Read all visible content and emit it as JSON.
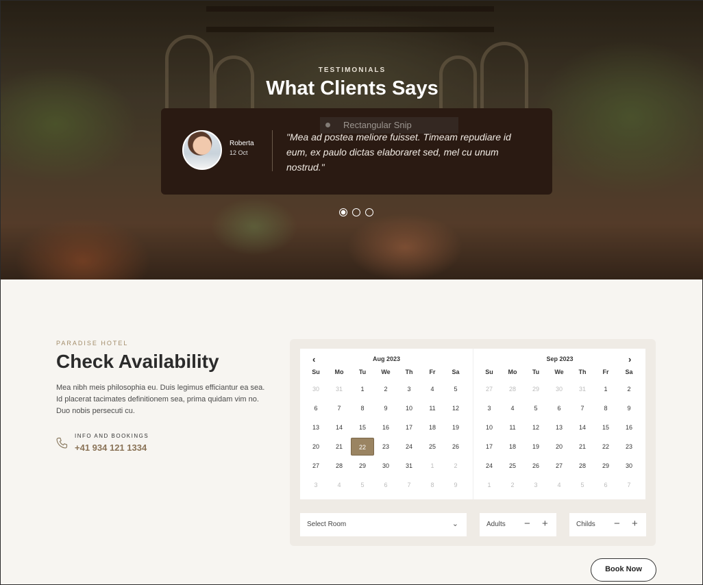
{
  "hero": {
    "eyebrow": "TESTIMONIALS",
    "title": "What Clients Says",
    "testimonial": {
      "name": "Roberta",
      "date": "12 Oct",
      "quote": "\"Mea ad postea meliore fuisset. Timeam repudiare id eum, ex paulo dictas elaboraret sed, mel cu unum nostrud.\""
    },
    "overlay_text": "Rectangular Snip",
    "carousel": {
      "count": 3,
      "active": 1
    }
  },
  "availability": {
    "eyebrow": "PARADISE HOTEL",
    "title": "Check Availability",
    "description": "Mea nibh meis philosophia eu. Duis legimus efficiantur ea sea. Id placerat tacimates definitionem sea, prima quidam vim no. Duo nobis persecuti cu.",
    "contact_label": "INFO AND BOOKINGS",
    "phone": "+41 934 121 1334"
  },
  "calendar": {
    "weekdays": [
      "Su",
      "Mo",
      "Tu",
      "We",
      "Th",
      "Fr",
      "Sa"
    ],
    "prev_icon": "chevron-left-icon",
    "next_icon": "chevron-right-icon",
    "selected": "22",
    "months": [
      {
        "label": "Aug 2023",
        "weeks": [
          [
            "30",
            "31",
            "1",
            "2",
            "3",
            "4",
            "5"
          ],
          [
            "6",
            "7",
            "8",
            "9",
            "10",
            "11",
            "12"
          ],
          [
            "13",
            "14",
            "15",
            "16",
            "17",
            "18",
            "19"
          ],
          [
            "20",
            "21",
            "22",
            "23",
            "24",
            "25",
            "26"
          ],
          [
            "27",
            "28",
            "29",
            "30",
            "31",
            "1",
            "2"
          ],
          [
            "3",
            "4",
            "5",
            "6",
            "7",
            "8",
            "9"
          ]
        ],
        "dim": [
          [
            0,
            0
          ],
          [
            0,
            1
          ],
          [
            4,
            5
          ],
          [
            4,
            6
          ],
          [
            5,
            0
          ],
          [
            5,
            1
          ],
          [
            5,
            2
          ],
          [
            5,
            3
          ],
          [
            5,
            4
          ],
          [
            5,
            5
          ],
          [
            5,
            6
          ]
        ],
        "selected_cell": [
          3,
          2
        ]
      },
      {
        "label": "Sep 2023",
        "weeks": [
          [
            "27",
            "28",
            "29",
            "30",
            "31",
            "1",
            "2"
          ],
          [
            "3",
            "4",
            "5",
            "6",
            "7",
            "8",
            "9"
          ],
          [
            "10",
            "11",
            "12",
            "13",
            "14",
            "15",
            "16"
          ],
          [
            "17",
            "18",
            "19",
            "20",
            "21",
            "22",
            "23"
          ],
          [
            "24",
            "25",
            "26",
            "27",
            "28",
            "29",
            "30"
          ],
          [
            "1",
            "2",
            "3",
            "4",
            "5",
            "6",
            "7"
          ]
        ],
        "dim": [
          [
            0,
            0
          ],
          [
            0,
            1
          ],
          [
            0,
            2
          ],
          [
            0,
            3
          ],
          [
            0,
            4
          ],
          [
            5,
            0
          ],
          [
            5,
            1
          ],
          [
            5,
            2
          ],
          [
            5,
            3
          ],
          [
            5,
            4
          ],
          [
            5,
            5
          ],
          [
            5,
            6
          ]
        ]
      }
    ]
  },
  "booking": {
    "room_select": "Select Room",
    "adults_label": "Adults",
    "childs_label": "Childs",
    "minus": "−",
    "plus": "+",
    "book_button": "Book Now"
  },
  "colors": {
    "accent": "#9a8462",
    "card": "#2a1a12",
    "panel": "#efebe5"
  }
}
